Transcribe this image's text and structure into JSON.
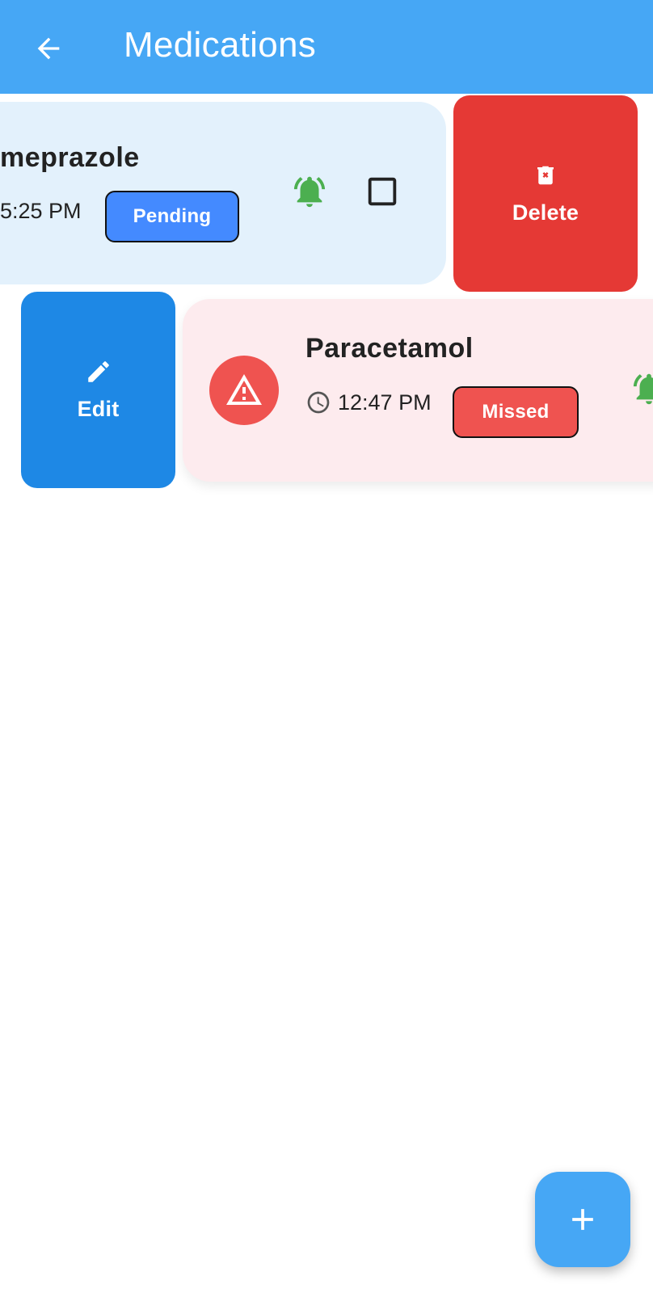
{
  "appbar": {
    "title": "Medications",
    "back_icon": "arrow-back-icon",
    "color": "#46a7f5"
  },
  "medications": [
    {
      "name": "meprazole",
      "time": "5:25 PM",
      "status": "Pending",
      "status_color": "#448aff",
      "card_color": "#e3f1fc",
      "icons": [
        "alarm-bell-icon",
        "checkbox-icon"
      ]
    },
    {
      "name": "Paracetamol",
      "time": "12:47 PM",
      "status": "Missed",
      "status_color": "#ef5350",
      "card_color": "#fdebee",
      "icons": [
        "warning-icon",
        "clock-icon",
        "alarm-bell-icon"
      ]
    }
  ],
  "actions": {
    "delete_label": "Delete",
    "delete_color": "#e53935",
    "edit_label": "Edit",
    "edit_color": "#1e88e5"
  },
  "fab": {
    "icon": "add-icon"
  }
}
